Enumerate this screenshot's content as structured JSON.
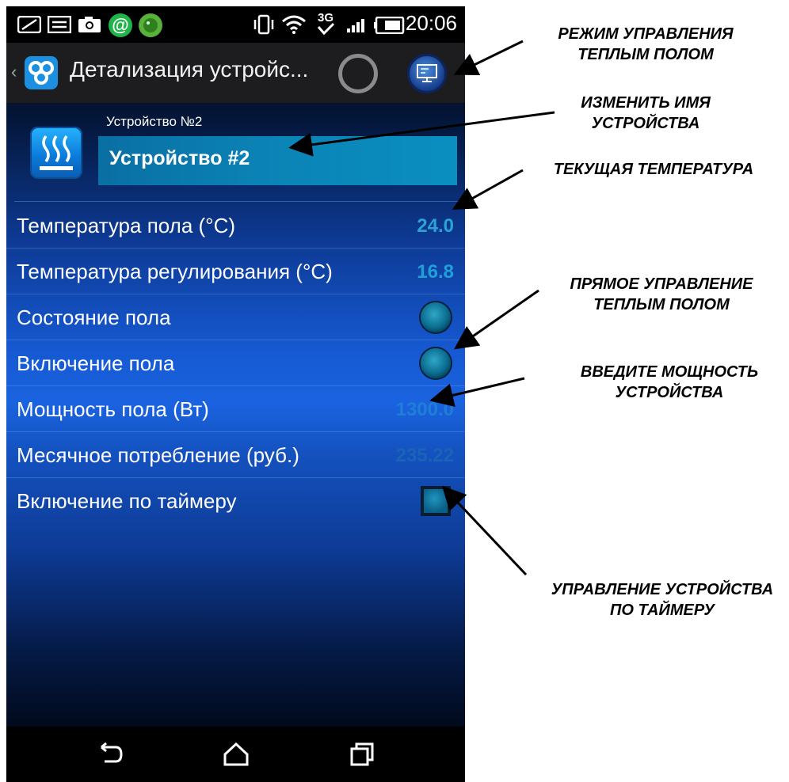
{
  "status_bar": {
    "time": "20:06",
    "network": "3G",
    "icons": [
      "message-icon",
      "gallery-icon",
      "camera-icon",
      "at-sign-icon",
      "shield-icon",
      "vibrate-icon",
      "wifi-icon",
      "network-3g-icon",
      "signal-icon",
      "battery-icon"
    ]
  },
  "action_bar": {
    "title": "Детализация устройс...",
    "icons": [
      "chevron-left-icon",
      "app-logo-icon",
      "progress-spinner",
      "monitor-icon"
    ]
  },
  "device": {
    "small_label": "Устройство №2",
    "name": "Устройство #2",
    "icon": "heated-floor-icon"
  },
  "rows": [
    {
      "label": "Температура пола (°C)",
      "value": "24.0",
      "value_color": "#2aa3d6",
      "control": "text"
    },
    {
      "label": "Температура регулирования (°C)",
      "value": "16.8",
      "value_color": "#1fa0d8",
      "control": "text"
    },
    {
      "label": "Состояние пола",
      "value": "",
      "control": "led"
    },
    {
      "label": "Включение пола",
      "value": "",
      "control": "led-button"
    },
    {
      "label": "Мощность пола (Вт)",
      "value": "1300.0",
      "value_color": "#1f7fd6",
      "control": "input"
    },
    {
      "label": "Месячное потребление (руб.)",
      "value": "235.22",
      "value_color": "#1a64b8",
      "control": "text"
    },
    {
      "label": "Включение по таймеру",
      "value": "",
      "control": "checkbox"
    }
  ],
  "nav_bar": {
    "icons": [
      "back-icon",
      "home-icon",
      "recent-apps-icon"
    ]
  },
  "annotations": [
    {
      "text1": "РЕЖИМ УПРАВЛЕНИЯ",
      "text2": "ТЕПЛЫМ ПОЛОМ"
    },
    {
      "text1": "ИЗМЕНИТЬ ИМЯ",
      "text2": "УСТРОЙСТВА"
    },
    {
      "text1": "ТЕКУЩАЯ ТЕМПЕРАТУРА",
      "text2": ""
    },
    {
      "text1": "ПРЯМОЕ УПРАВЛЕНИЕ",
      "text2": "ТЕПЛЫМ ПОЛОМ"
    },
    {
      "text1": "ВВЕДИТЕ МОЩНОСТЬ",
      "text2": "УСТРОЙСТВА"
    },
    {
      "text1": "УПРАВЛЕНИЕ УСТРОЙСТВА",
      "text2": "ПО ТАЙМЕРУ"
    }
  ]
}
